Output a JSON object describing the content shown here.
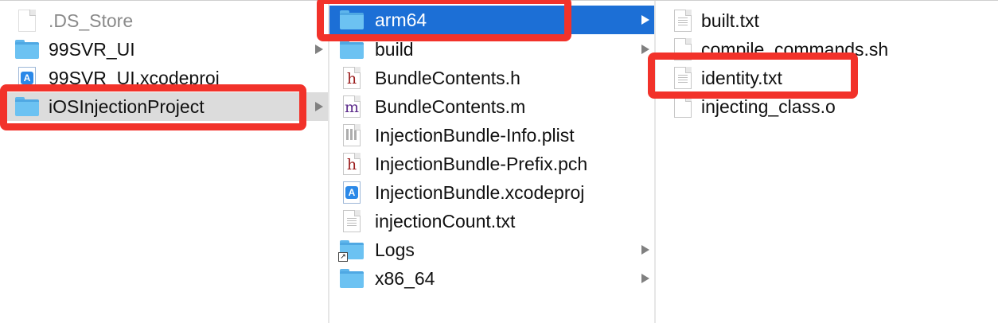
{
  "column1": {
    "items": [
      {
        "label": ".DS_Store",
        "icon": "document-icon",
        "dim": true
      },
      {
        "label": "99SVR_UI",
        "icon": "folder-icon",
        "arrow": true
      },
      {
        "label": "99SVR_UI.xcodeproj",
        "icon": "xcodeproj-icon"
      },
      {
        "label": "iOSInjectionProject",
        "icon": "folder-icon",
        "arrow": true,
        "selected": true
      }
    ]
  },
  "column2": {
    "items": [
      {
        "label": "arm64",
        "icon": "folder-icon",
        "arrow": true,
        "selected": true
      },
      {
        "label": "build",
        "icon": "folder-icon",
        "arrow": true
      },
      {
        "label": "BundleContents.h",
        "icon": "header-file-icon"
      },
      {
        "label": "BundleContents.m",
        "icon": "objc-file-icon"
      },
      {
        "label": "InjectionBundle-Info.plist",
        "icon": "plist-file-icon"
      },
      {
        "label": "InjectionBundle-Prefix.pch",
        "icon": "header-file-icon"
      },
      {
        "label": "InjectionBundle.xcodeproj",
        "icon": "xcodeproj-icon"
      },
      {
        "label": "injectionCount.txt",
        "icon": "text-file-icon"
      },
      {
        "label": "Logs",
        "icon": "folder-alias-icon",
        "arrow": true
      },
      {
        "label": "x86_64",
        "icon": "folder-icon",
        "arrow": true
      }
    ]
  },
  "column3": {
    "items": [
      {
        "label": "built.txt",
        "icon": "text-file-icon"
      },
      {
        "label": "compile_commands.sh",
        "icon": "document-icon"
      },
      {
        "label": "identity.txt",
        "icon": "text-file-icon"
      },
      {
        "label": "injecting_class.o",
        "icon": "document-icon"
      }
    ]
  },
  "colors": {
    "selection_blue": "#1c6fd6",
    "selection_gray": "#dcdcdc",
    "highlight_red": "#f2322a",
    "folder_blue": "#6cc2f2"
  }
}
